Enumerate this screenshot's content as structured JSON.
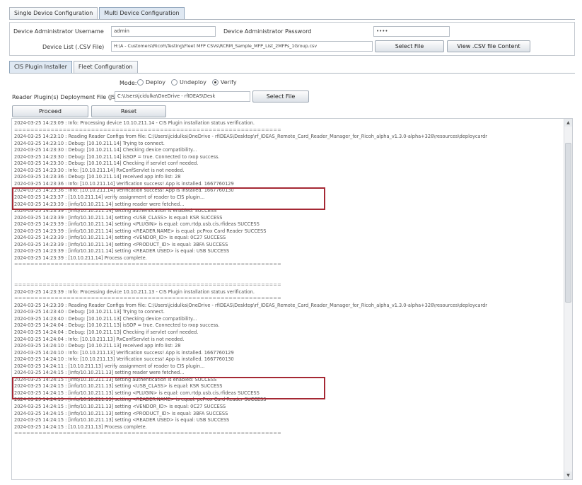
{
  "main_tabs": [
    {
      "label": "Single Device Configuration",
      "active": false
    },
    {
      "label": "Multi Device Configuration",
      "active": true
    }
  ],
  "device_admin": {
    "username_label": "Device Administrator Username",
    "username_value": "admin",
    "password_label": "Device Administrator Password",
    "password_value": "••••"
  },
  "device_list": {
    "label": "Device List (.CSV File)",
    "value": "H:\\A - Customers\\Ricoh\\Testing\\Fleet MFP CSVs\\RCRM_Sample_MFP_List_2MFPs_1Group.csv",
    "select_button": "Select File",
    "view_button": "View .CSV file Content"
  },
  "sub_tabs": [
    {
      "label": "CIS Plugin Installer",
      "active": true
    },
    {
      "label": "Fleet Configuration",
      "active": false
    }
  ],
  "mode": {
    "label": "Mode:",
    "options": [
      {
        "label": "Deploy",
        "selected": false
      },
      {
        "label": "Undeploy",
        "selected": false
      },
      {
        "label": "Verify",
        "selected": true
      }
    ]
  },
  "reader_plugins": {
    "label": "Reader Plugin(s) Deployment File (JSON)",
    "value": "C:\\Users\\jcidulka\\OneDrive - rfIDEAS\\Desk",
    "select_button": "Select File"
  },
  "actions": {
    "proceed": "Proceed",
    "reset": "Reset"
  },
  "log": [
    "2024-03-25 14:23:09 : Info: Processing device 10.10.211.14 - CIS Plugin installation status verification.",
    "==================================================================",
    "2024-03-25 14:23:10 : Reading Reader Configs from file: C:\\Users\\jcidulka\\OneDrive - rfIDEAS\\Desktop\\rf_IDEAS_Remote_Card_Reader_Manager_for_Ricoh_alpha_v1.3.0-alpha+328\\resources\\deploycardr",
    "2024-03-25 14:23:10 : Debug: [10.10.211.14] Trying to connect.",
    "2024-03-25 14:23:30 : Debug: [10.10.211.14] Checking device compatibility...",
    "2024-03-25 14:23:30 : Debug: [10.10.211.14] isSOP = true. Connected to rxop success.",
    "2024-03-25 14:23:30 : Debug: [10.10.211.14] Checking if servlet conf needed.",
    "2024-03-25 14:23:30 : Info: [10.10.211.14] RxConfServlet is not needed.",
    "2024-03-25 14:23:36 : Debug: [10.10.211.14] received app info list: 28",
    "2024-03-25 14:23:36 : Info: [10.10.211.14] Verification success! App is installed. 1667760129",
    "2024-03-25 14:23:36 : Info: [10.10.211.14] Verification success! App is installed. 1667760130",
    "2024-03-25 14:23:37 : [10.10.211.14] verify assignment of reader to CIS plugin...",
    "2024-03-25 14:23:39 : [info/10.10.211.14] setting reader were fetched...",
    "2024-03-25 14:23:39 : [info/10.10.211.14] setting authentication is enabled: SUCCESS",
    "2024-03-25 14:23:39 : [info/10.10.211.14] setting <USB_CLASS> is equal: KSR SUCCESS",
    "2024-03-25 14:23:39 : [info/10.10.211.14] setting <PLUGIN> is equal: com.rtdp.usb.cis.rfideas SUCCESS",
    "2024-03-25 14:23:39 : [info/10.10.211.14] setting <READER.NAME> is equal: pcProx Card Reader SUCCESS",
    "2024-03-25 14:23:39 : [info/10.10.211.14] setting <VENDOR_ID> is equal: 0C27 SUCCESS",
    "2024-03-25 14:23:39 : [info/10.10.211.14] setting <PRODUCT_ID> is equal: 3BFA SUCCESS",
    "2024-03-25 14:23:39 : [info/10.10.211.14] setting <READER USED> is equal: USB SUCCESS",
    "2024-03-25 14:23:39 : [10.10.211.14] Process complete.",
    "==================================================================",
    "",
    "",
    "==================================================================",
    "2024-03-25 14:23:39 : Info: Processing device 10.10.211.13 - CIS Plugin installation status verification.",
    "==================================================================",
    "2024-03-25 14:23:39 : Reading Reader Configs from file: C:\\Users\\jcidulka\\OneDrive - rfIDEAS\\Desktop\\rf_IDEAS_Remote_Card_Reader_Manager_for_Ricoh_alpha_v1.3.0-alpha+328\\resources\\deploycardr",
    "2024-03-25 14:23:40 : Debug: [10.10.211.13] Trying to connect.",
    "2024-03-25 14:23:40 : Debug: [10.10.211.13] Checking device compatibility...",
    "2024-03-25 14:24:04 : Debug: [10.10.211.13] isSOP = true. Connected to rxop success.",
    "2024-03-25 14:24:04 : Debug: [10.10.211.13] Checking if servlet conf needed.",
    "2024-03-25 14:24:04 : Info: [10.10.211.13] RxConfServlet is not needed.",
    "2024-03-25 14:24:10 : Debug: [10.10.211.13] received app info list: 28",
    "2024-03-25 14:24:10 : Info: [10.10.211.13] Verification success! App is installed. 1667760129",
    "2024-03-25 14:24:10 : Info: [10.10.211.13] Verification success! App is installed. 1667760130",
    "2024-03-25 14:24:11 : [10.10.211.13] verify assignment of reader to CIS plugin...",
    "2024-03-25 14:24:15 : [info/10.10.211.13] setting reader were fetched...",
    "2024-03-25 14:24:15 : [info/10.10.211.13] setting authentication is enabled: SUCCESS",
    "2024-03-25 14:24:15 : [info/10.10.211.13] setting <USB_CLASS> is equal: KSR SUCCESS",
    "2024-03-25 14:24:15 : [info/10.10.211.13] setting <PLUGIN> is equal: com.rtdp.usb.cis.rfideas SUCCESS",
    "2024-03-25 14:24:15 : [info/10.10.211.13] setting <READER.NAME> is equal: pcProx Card Reader SUCCESS",
    "2024-03-25 14:24:15 : [info/10.10.211.13] setting <VENDOR_ID> is equal: 0C27 SUCCESS",
    "2024-03-25 14:24:15 : [info/10.10.211.13] setting <PRODUCT_ID> is equal: 3BFA SUCCESS",
    "2024-03-25 14:24:15 : [info/10.10.211.13] setting <READER USED> is equal: USB SUCCESS",
    "2024-03-25 14:24:15 : [10.10.211.13] Process complete.",
    "=================================================================="
  ],
  "highlights": [
    [
      9,
      10
    ],
    [
      34,
      35
    ]
  ],
  "colors": {
    "highlight": "#a52834"
  }
}
